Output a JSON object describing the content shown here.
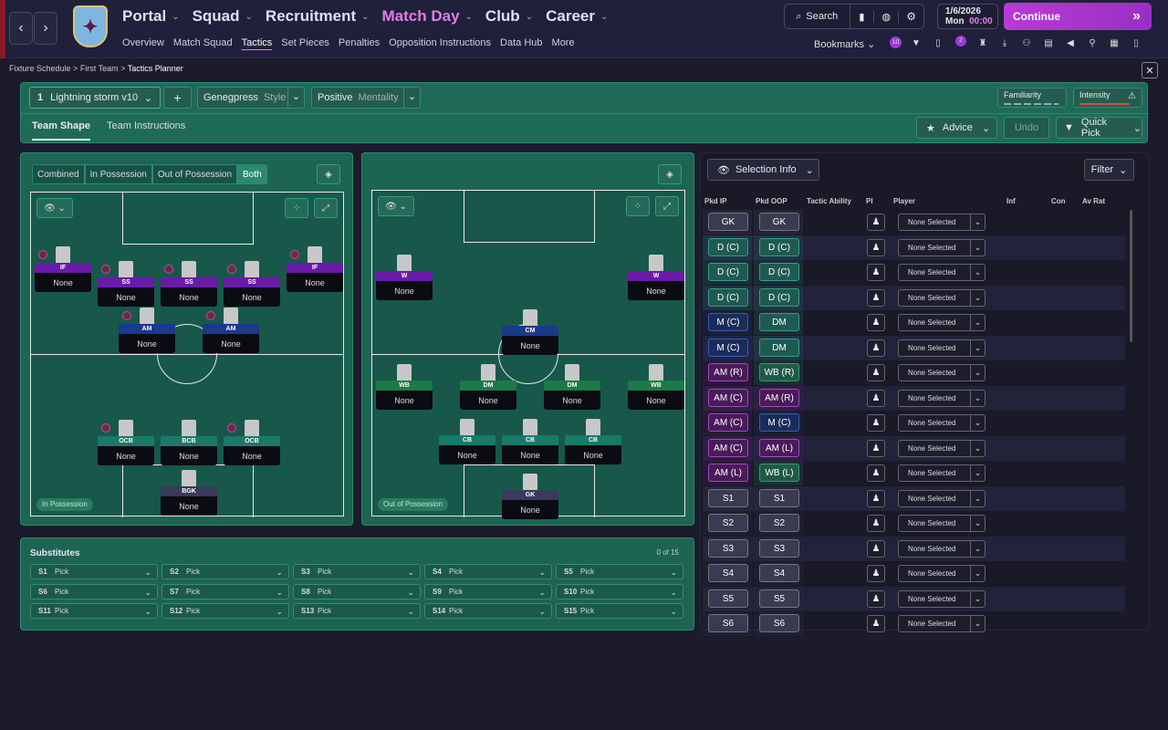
{
  "nav": {
    "main": [
      "Portal",
      "Squad",
      "Recruitment",
      "Match Day",
      "Club",
      "Career"
    ],
    "active": "Match Day",
    "sub": [
      "Overview",
      "Match Squad",
      "Tactics",
      "Set Pieces",
      "Penalties",
      "Opposition Instructions",
      "Data Hub",
      "More"
    ],
    "sub_selected": "Tactics",
    "search": "Search",
    "date": "1/6/2026",
    "day": "Mon",
    "time": "00:00",
    "continue": "Continue",
    "bookmarks": "Bookmarks",
    "badge1": "10",
    "badge2": "2"
  },
  "crumbs": [
    "Fixture Schedule",
    "First Team",
    "Tactics Planner"
  ],
  "tactic": {
    "num": "1",
    "name": "Lightning storm v10",
    "style": "Genegpress",
    "style_label": "Style",
    "mentality": "Positive",
    "mentality_label": "Mentality",
    "familiarity": "Familiarity",
    "intensity": "Intensity",
    "tabs": [
      "Team Shape",
      "Team Instructions"
    ],
    "advice": "Advice",
    "undo": "Undo",
    "quick_pick": "Quick Pick"
  },
  "shape": {
    "filters": [
      "Combined",
      "In Possession",
      "Out of Possession",
      "Both"
    ],
    "selected": "Both",
    "in_tag": "In Possession",
    "out_tag": "Out of Possession"
  },
  "ip_players": [
    {
      "role": "IF",
      "name": "None",
      "color": "#6a1aa8"
    },
    {
      "role": "SS",
      "name": "None",
      "color": "#6a1aa8"
    },
    {
      "role": "SS",
      "name": "None",
      "color": "#6a1aa8"
    },
    {
      "role": "SS",
      "name": "None",
      "color": "#6a1aa8"
    },
    {
      "role": "IF",
      "name": "None",
      "color": "#6a1aa8"
    },
    {
      "role": "AM",
      "name": "None",
      "color": "#1a3a8a"
    },
    {
      "role": "AM",
      "name": "None",
      "color": "#1a3a8a"
    },
    {
      "role": "OCB",
      "name": "None",
      "color": "#1a7a6a"
    },
    {
      "role": "BCB",
      "name": "None",
      "color": "#1a7a6a"
    },
    {
      "role": "OCB",
      "name": "None",
      "color": "#1a7a6a"
    },
    {
      "role": "BGK",
      "name": "None",
      "color": "#3a3a5a"
    }
  ],
  "oop_players": [
    {
      "role": "W",
      "name": "None",
      "color": "#6a1aa8"
    },
    {
      "role": "W",
      "name": "None",
      "color": "#6a1aa8"
    },
    {
      "role": "CM",
      "name": "None",
      "color": "#1a3a8a"
    },
    {
      "role": "WB",
      "name": "None",
      "color": "#1a7a4a"
    },
    {
      "role": "DM",
      "name": "None",
      "color": "#1a7a4a"
    },
    {
      "role": "DM",
      "name": "None",
      "color": "#1a7a4a"
    },
    {
      "role": "WB",
      "name": "None",
      "color": "#1a7a4a"
    },
    {
      "role": "CB",
      "name": "None",
      "color": "#1a7a6a"
    },
    {
      "role": "CB",
      "name": "None",
      "color": "#1a7a6a"
    },
    {
      "role": "CB",
      "name": "None",
      "color": "#1a7a6a"
    },
    {
      "role": "GK",
      "name": "None",
      "color": "#3a3a5a"
    }
  ],
  "selection": {
    "title": "Selection Info",
    "filter": "Filter",
    "headers": [
      "Pkd IP",
      "Pkd OOP",
      "Tactic Ability",
      "PI",
      "Player",
      "Inf",
      "Con",
      "Av Rat"
    ],
    "rows": [
      [
        "GK",
        "GK"
      ],
      [
        "D (C)",
        "D (C)"
      ],
      [
        "D (C)",
        "D (C)"
      ],
      [
        "D (C)",
        "D (C)"
      ],
      [
        "M (C)",
        "DM"
      ],
      [
        "M (C)",
        "DM"
      ],
      [
        "AM (R)",
        "WB (R)"
      ],
      [
        "AM (C)",
        "AM (R)"
      ],
      [
        "AM (C)",
        "M (C)"
      ],
      [
        "AM (C)",
        "AM (L)"
      ],
      [
        "AM (L)",
        "WB (L)"
      ],
      [
        "S1",
        "S1"
      ],
      [
        "S2",
        "S2"
      ],
      [
        "S3",
        "S3"
      ],
      [
        "S4",
        "S4"
      ],
      [
        "S5",
        "S5"
      ],
      [
        "S6",
        "S6"
      ]
    ],
    "player_value": "None Selected"
  },
  "subs": {
    "title": "Substitutes",
    "count": "0 of 15",
    "pick": "Pick",
    "slots": [
      "S1",
      "S2",
      "S3",
      "S4",
      "S5",
      "S6",
      "S7",
      "S8",
      "S9",
      "S10",
      "S11",
      "S12",
      "S13",
      "S14",
      "S15"
    ]
  }
}
